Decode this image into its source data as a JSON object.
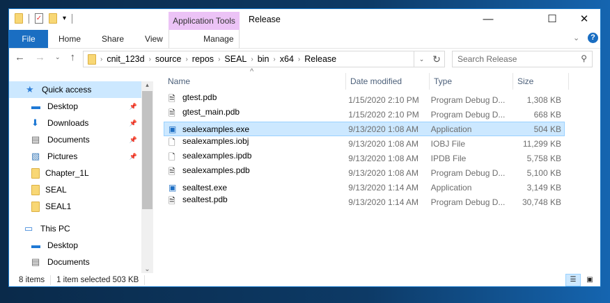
{
  "window": {
    "title": "Release",
    "context_tab_group": "Application Tools",
    "minimize": "—",
    "maximize": "☐",
    "close": "✕"
  },
  "ribbon": {
    "tabs": [
      "File",
      "Home",
      "Share",
      "View",
      "Manage"
    ],
    "help": "?"
  },
  "address": {
    "breadcrumbs": [
      "cnit_123d",
      "source",
      "repos",
      "SEAL",
      "bin",
      "x64",
      "Release"
    ]
  },
  "search": {
    "placeholder": "Search Release"
  },
  "sidebar": {
    "items": [
      {
        "label": "Quick access",
        "icon": "star-icon",
        "selected": true
      },
      {
        "label": "Desktop",
        "icon": "desktop-icon",
        "pinned": true
      },
      {
        "label": "Downloads",
        "icon": "download-icon",
        "pinned": true
      },
      {
        "label": "Documents",
        "icon": "documents-icon",
        "pinned": true
      },
      {
        "label": "Pictures",
        "icon": "pictures-icon",
        "pinned": true
      },
      {
        "label": "Chapter_1L",
        "icon": "folder-icon"
      },
      {
        "label": "SEAL",
        "icon": "folder-icon"
      },
      {
        "label": "SEAL1",
        "icon": "folder-icon"
      },
      {
        "label": "This PC",
        "icon": "pc-icon",
        "section": true
      },
      {
        "label": "Desktop",
        "icon": "desktop-icon"
      },
      {
        "label": "Documents",
        "icon": "documents-icon"
      }
    ]
  },
  "columns": [
    "Name",
    "Date modified",
    "Type",
    "Size"
  ],
  "files": [
    {
      "name": "gtest.pdb",
      "date": "1/15/2020 2:10 PM",
      "type": "Program Debug D...",
      "size": "1,308 KB",
      "icon": "pdb-file-icon"
    },
    {
      "name": "gtest_main.pdb",
      "date": "1/15/2020 2:10 PM",
      "type": "Program Debug D...",
      "size": "668 KB",
      "icon": "pdb-file-icon"
    },
    {
      "name": "sealexamples.exe",
      "date": "9/13/2020 1:08 AM",
      "type": "Application",
      "size": "504 KB",
      "icon": "exe-file-icon",
      "selected": true
    },
    {
      "name": "sealexamples.iobj",
      "date": "9/13/2020 1:08 AM",
      "type": "IOBJ File",
      "size": "11,299 KB",
      "icon": "blank-file-icon"
    },
    {
      "name": "sealexamples.ipdb",
      "date": "9/13/2020 1:08 AM",
      "type": "IPDB File",
      "size": "5,758 KB",
      "icon": "blank-file-icon"
    },
    {
      "name": "sealexamples.pdb",
      "date": "9/13/2020 1:08 AM",
      "type": "Program Debug D...",
      "size": "5,100 KB",
      "icon": "pdb-file-icon"
    },
    {
      "name": "sealtest.exe",
      "date": "9/13/2020 1:14 AM",
      "type": "Application",
      "size": "3,149 KB",
      "icon": "exe-file-icon"
    },
    {
      "name": "sealtest.pdb",
      "date": "9/13/2020 1:14 AM",
      "type": "Program Debug D...",
      "size": "30,748 KB",
      "icon": "pdb-file-icon"
    }
  ],
  "status": {
    "count": "8 items",
    "selection": "1 item selected  503 KB"
  },
  "colors": {
    "accent": "#1a6ec2",
    "selection": "#cce8ff",
    "context_tab": "#ecc3f6"
  }
}
